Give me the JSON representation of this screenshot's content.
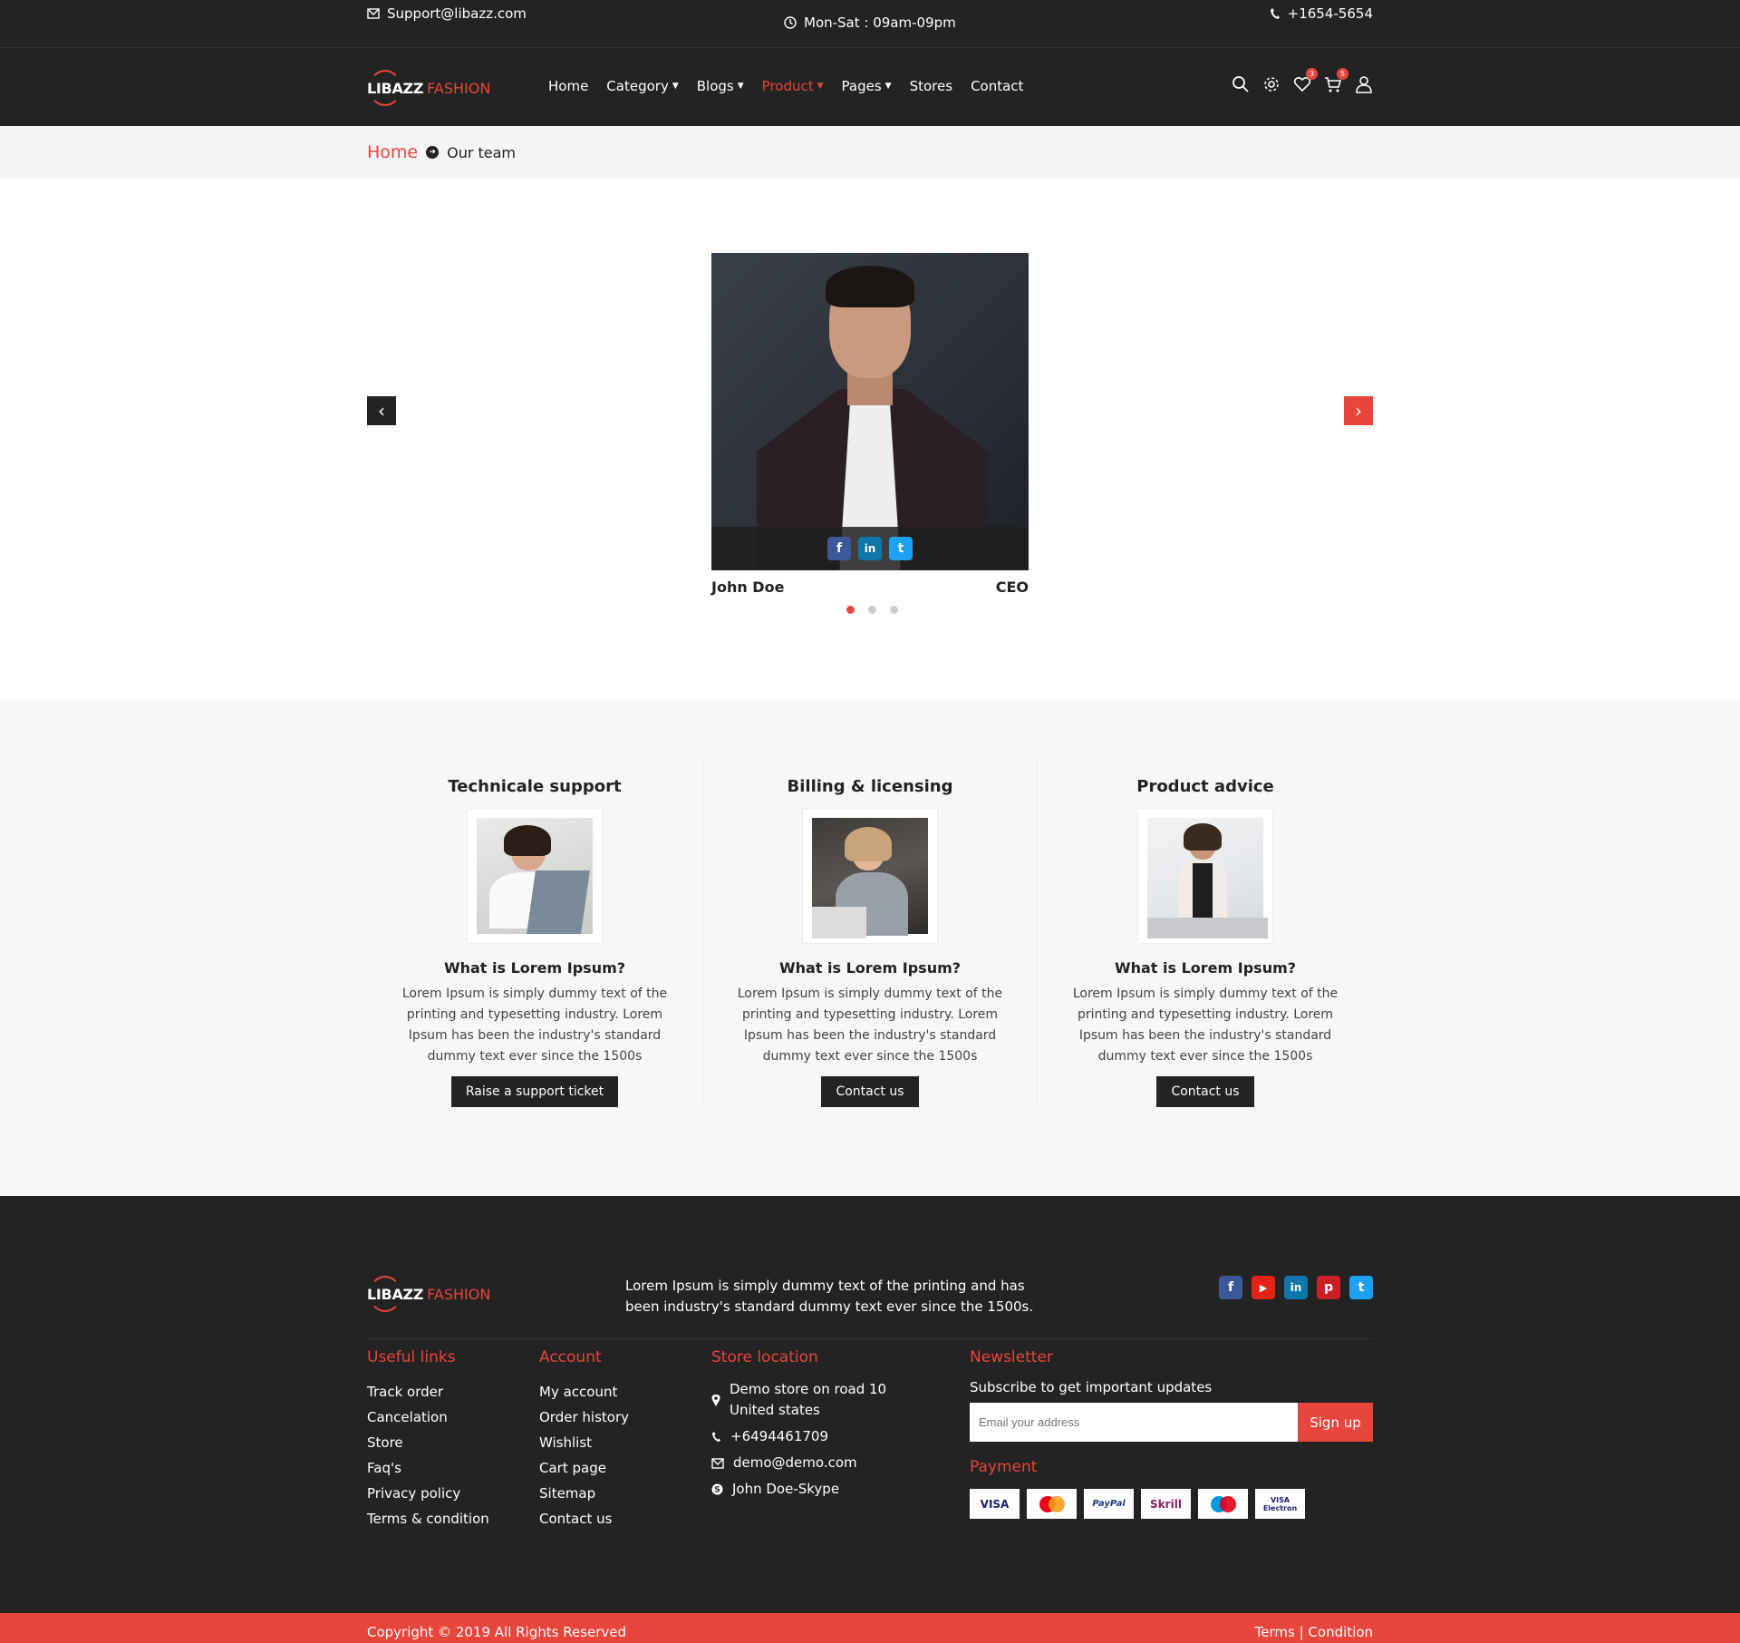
{
  "topbar": {
    "email": "Support@libazz.com",
    "hours": "Mon-Sat : 09am-09pm",
    "phone": "+1654-5654"
  },
  "brand": {
    "name_main": "LIBAZZ",
    "name_accent": "FASHION",
    "accent_color": "#e8453c",
    "dark_color": "#232323"
  },
  "nav": {
    "items": [
      {
        "label": "Home",
        "dropdown": false
      },
      {
        "label": "Category",
        "dropdown": true
      },
      {
        "label": "Blogs",
        "dropdown": true
      },
      {
        "label": "Product",
        "dropdown": true,
        "active": true
      },
      {
        "label": "Pages",
        "dropdown": true
      },
      {
        "label": "Stores",
        "dropdown": false
      },
      {
        "label": "Contact",
        "dropdown": false
      }
    ],
    "wishlist_count": "3",
    "cart_count": "5"
  },
  "breadcrumb": {
    "home": "Home",
    "current": "Our team"
  },
  "team": {
    "member_name": "John Doe",
    "member_role": "CEO",
    "prev_arrow": "‹",
    "next_arrow": "›",
    "dot_count": 3,
    "active_dot": 0
  },
  "support": [
    {
      "title": "Technicale support",
      "question": "What is Lorem Ipsum?",
      "text": "Lorem Ipsum is simply dummy text of the printing and typesetting industry. Lorem Ipsum has been the industry's standard dummy text ever since the 1500s",
      "button": "Raise a support ticket"
    },
    {
      "title": "Billing & licensing",
      "question": "What is Lorem Ipsum?",
      "text": "Lorem Ipsum is simply dummy text of the printing and typesetting industry. Lorem Ipsum has been the industry's standard dummy text ever since the 1500s",
      "button": "Contact us"
    },
    {
      "title": "Product advice",
      "question": "What is Lorem Ipsum?",
      "text": "Lorem Ipsum is simply dummy text of the printing and typesetting industry. Lorem Ipsum has been the industry's standard dummy text ever since the 1500s",
      "button": "Contact us"
    }
  ],
  "footer": {
    "about": "Lorem Ipsum is simply dummy text of the printing and has been industry's standard dummy text ever since the 1500s.",
    "useful_links": {
      "title": "Useful links",
      "links": [
        "Track order",
        "Cancelation",
        "Store",
        "Faq's",
        "Privacy policy",
        "Terms & condition"
      ]
    },
    "account": {
      "title": "Account",
      "links": [
        "My account",
        "Order history",
        "Wishlist",
        "Cart page",
        "Sitemap",
        "Contact us"
      ]
    },
    "store": {
      "title": "Store location",
      "address_line1": "Demo store on road 10",
      "address_line2": "United states",
      "phone": "+6494461709",
      "email": "demo@demo.com",
      "skype": "John Doe-Skype"
    },
    "newsletter": {
      "title": "Newsletter",
      "subtitle": "Subscribe to get important updates",
      "placeholder": "Email your address",
      "button": "Sign up"
    },
    "payment": {
      "title": "Payment",
      "methods": [
        "VISA",
        "MasterCard",
        "PayPal",
        "Skrill",
        "Maestro",
        "VISA Electron"
      ]
    },
    "copyright": "Copyright © 2019 All Rights Reserved",
    "terms": "Terms | Condition"
  }
}
